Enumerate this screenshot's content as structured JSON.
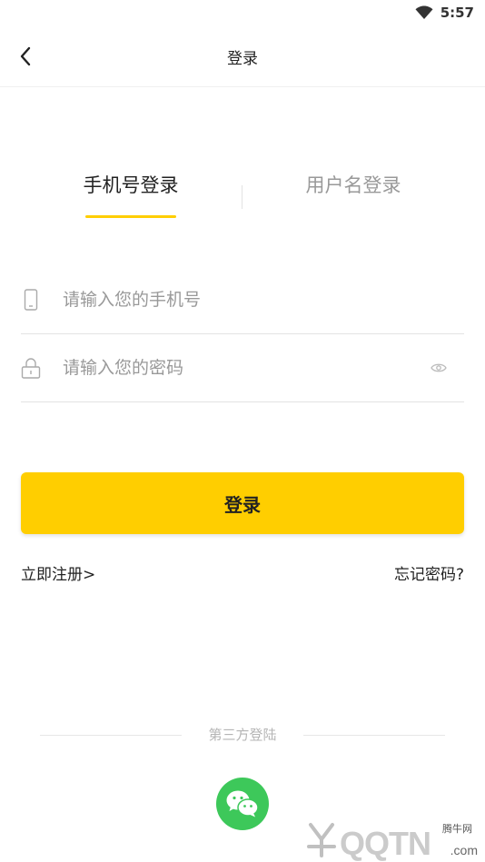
{
  "status_bar": {
    "time": "5:57"
  },
  "header": {
    "title": "登录"
  },
  "tabs": [
    {
      "label": "手机号登录",
      "active": true
    },
    {
      "label": "用户名登录",
      "active": false
    }
  ],
  "form": {
    "phone_placeholder": "请输入您的手机号",
    "password_placeholder": "请输入您的密码"
  },
  "login_button": "登录",
  "links": {
    "register": "立即注册>",
    "forgot": "忘记密码?"
  },
  "third_party": {
    "label": "第三方登陆"
  },
  "watermark": {
    "brand_cn": "腾牛网",
    "brand": "QQTN",
    "suffix": ".com"
  },
  "colors": {
    "accent": "#FFCE00",
    "wechat": "#3DC85A",
    "inactive_text": "#999999"
  }
}
